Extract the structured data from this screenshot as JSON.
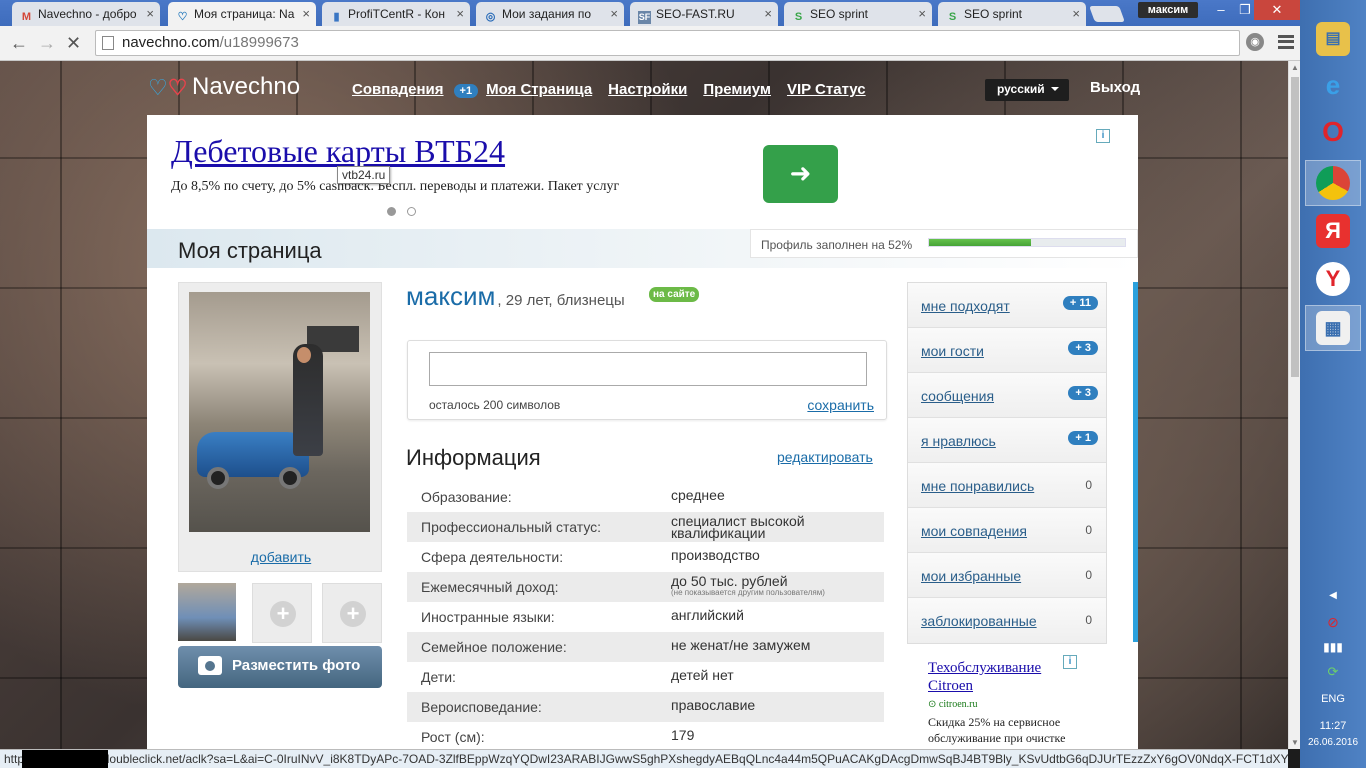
{
  "browser": {
    "tabs": [
      {
        "title": "Navechno - добро",
        "icon": "M",
        "icon_color": "#d44638"
      },
      {
        "title": "Моя страница: Na",
        "icon": "♡",
        "icon_color": "#2f7fbf"
      },
      {
        "title": "ProfiTCentR - Кон",
        "icon": "▮",
        "icon_color": "#3a76c4"
      },
      {
        "title": "Мои задания по",
        "icon": "◎",
        "icon_color": "#2a6cb8"
      },
      {
        "title": "SEO-FAST.RU",
        "icon": "SF",
        "icon_color": "#6a86a8"
      },
      {
        "title": "SEO sprint",
        "icon": "S",
        "icon_color": "#3aa64a"
      },
      {
        "title": "SEO sprint",
        "icon": "S",
        "icon_color": "#3aa64a"
      }
    ],
    "user": "максим",
    "url_domain": "navechno.com",
    "url_path": "/u18999673",
    "status_url": "http://googleads.g.doubleclick.net/aclk?sa=L&ai=C-0IruINvV_i8K8TDyAPc-7OAD-3ZlfBEppWzqYQDwI23ARABIJGwwS5ghPXshegdyAEBqQLnc4a44m5QPuACAKgDAcgDmwSqBJ4BT9Bly_KSvUdtbG6qDJUrTEzzZxY6gOV0NdqX-FCT1dXYc5DX..."
  },
  "site": {
    "logo": "Navechno",
    "nav": {
      "matches": "Совпадения",
      "matches_badge": "+1",
      "my_page": "Моя Страница",
      "settings": "Настройки",
      "premium": "Премиум",
      "vip": "VIP Статус"
    },
    "language": "русский",
    "logout": "Выход"
  },
  "ad_top": {
    "title": "Дебетовые карты ВТБ24",
    "description": "До 8,5% по счету, до 5% cashback. Беспл. переводы и платежи. Пакет услуг",
    "tooltip": "vtb24.ru",
    "arrow": "➜",
    "info": "i"
  },
  "page": {
    "title": "Моя страница",
    "progress_label": "Профиль заполнен на 52%",
    "progress_value": 0.52
  },
  "profile": {
    "name": "максим",
    "meta": ", 29 лет, близнецы",
    "online": "на сайте",
    "add_photo": "добавить",
    "upload_button": "Разместить фото",
    "status_remaining": "осталось 200 символов",
    "status_save": "сохранить",
    "info_title": "Информация",
    "edit": "редактировать",
    "info": [
      {
        "k": "Образование:",
        "v": "среднее",
        "note": ""
      },
      {
        "k": "Профессиональный статус:",
        "v": "специалист высокой квалификации",
        "note": ""
      },
      {
        "k": "Сфера деятельности:",
        "v": "производство",
        "note": ""
      },
      {
        "k": "Ежемесячный доход:",
        "v": "до 50 тыс. рублей",
        "note": "(не показывается другим пользователям)"
      },
      {
        "k": "Иностранные языки:",
        "v": "английский",
        "note": ""
      },
      {
        "k": "Семейное положение:",
        "v": "не женат/не замужем",
        "note": ""
      },
      {
        "k": "Дети:",
        "v": "детей нет",
        "note": ""
      },
      {
        "k": "Вероисповедание:",
        "v": "православие",
        "note": ""
      },
      {
        "k": "Рост (см):",
        "v": "179",
        "note": ""
      }
    ]
  },
  "side_menu": [
    {
      "label": "мне подходят",
      "count": "+ 11"
    },
    {
      "label": "мои гости",
      "count": "+ 3"
    },
    {
      "label": "сообщения",
      "count": "+ 3"
    },
    {
      "label": "я нравлюсь",
      "count": "+ 1"
    },
    {
      "label": "мне понравились",
      "zero": "0"
    },
    {
      "label": "мои совпадения",
      "zero": "0"
    },
    {
      "label": "мои избранные",
      "zero": "0"
    },
    {
      "label": "заблокированные",
      "zero": "0"
    }
  ],
  "ad_side": {
    "title": "Техобслуживание Citroen",
    "url": "citroen.ru",
    "desc": "Скидка 25% на сервисное обслуживание при очистке"
  },
  "taskbar": {
    "lang": "ENG",
    "time": "11:27",
    "date": "26.06.2016",
    "icons": [
      "file-explorer-icon",
      "ie-icon",
      "opera-icon",
      "chrome-icon",
      "yandex-icon",
      "yandex-browser-icon",
      "news-icon"
    ]
  }
}
